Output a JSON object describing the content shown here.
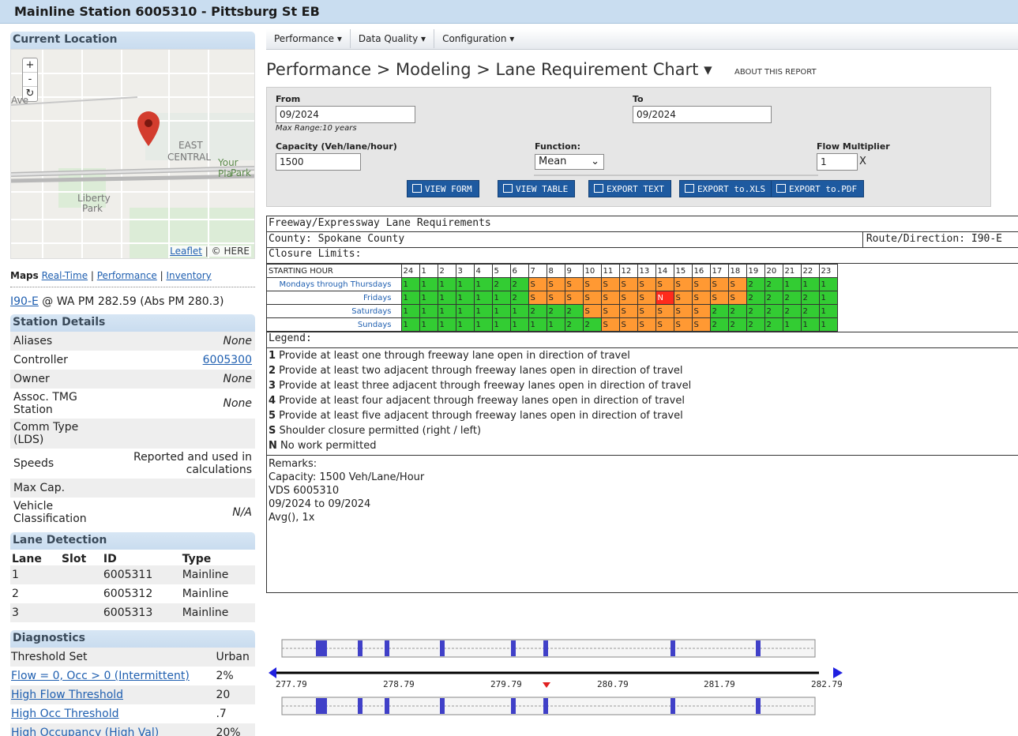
{
  "page_title": "Mainline Station 6005310 - Pittsburg St EB",
  "sidebar": {
    "current_location_title": "Current Location",
    "map": {
      "zoom_in": "+",
      "zoom_out": "-",
      "labels": [
        "Ave",
        "EAST",
        "CENTRAL",
        "Your Pla",
        "Park",
        "Liberty",
        "Park"
      ],
      "attribution_link": "Leaflet",
      "attribution_text": "| © HERE"
    },
    "maps_label": "Maps",
    "maps_links": [
      "Real-Time",
      "Performance",
      "Inventory"
    ],
    "route_link": "I90-E",
    "route_text": "@ WA PM 282.59 (Abs PM 280.3)",
    "station_details_title": "Station Details",
    "station_details": [
      {
        "label": "Aliases",
        "value": "None"
      },
      {
        "label": "Controller",
        "value": "6005300"
      },
      {
        "label": "Owner",
        "value": "None"
      },
      {
        "label": "Assoc. TMG Station",
        "value": "None"
      },
      {
        "label": "Comm Type (LDS)",
        "value": ""
      },
      {
        "label": "Speeds",
        "value": "Reported and used in calculations"
      },
      {
        "label": "Max Cap.",
        "value": ""
      },
      {
        "label": "Vehicle Classification",
        "value": "N/A"
      }
    ],
    "lane_detection_title": "Lane Detection",
    "lane_headers": [
      "Lane",
      "Slot",
      "ID",
      "Type"
    ],
    "lanes": [
      {
        "lane": "1",
        "slot": "",
        "id": "6005311",
        "type": "Mainline"
      },
      {
        "lane": "2",
        "slot": "",
        "id": "6005312",
        "type": "Mainline"
      },
      {
        "lane": "3",
        "slot": "",
        "id": "6005313",
        "type": "Mainline"
      }
    ],
    "diagnostics_title": "Diagnostics",
    "diagnostics": [
      {
        "label": "Threshold Set",
        "value": "Urban"
      },
      {
        "label": "Flow = 0, Occ > 0 (Intermittent)",
        "value": "2%"
      },
      {
        "label": "High Flow Threshold",
        "value": "20"
      },
      {
        "label": "High Occ Threshold",
        "value": ".7"
      },
      {
        "label": "High Occupancy (High Val)",
        "value": "20%"
      }
    ]
  },
  "menu": [
    "Performance ▾",
    "Data Quality ▾",
    "Configuration ▾"
  ],
  "breadcrumb": "Performance > Modeling > Lane Requirement Chart ▾",
  "about_link": "ABOUT THIS REPORT",
  "form": {
    "from_label": "From",
    "from_value": "09/2024",
    "max_range": "Max Range:10 years",
    "to_label": "To",
    "to_value": "09/2024",
    "capacity_label": "Capacity (Veh/lane/hour)",
    "capacity_value": "1500",
    "function_label": "Function:",
    "function_value": "Mean",
    "flow_label": "Flow Multiplier",
    "flow_value": "1",
    "flow_suffix": "X",
    "buttons": [
      "VIEW FORM",
      "VIEW TABLE",
      "EXPORT TEXT",
      "EXPORT to.XLS",
      "EXPORT to.PDF"
    ]
  },
  "report": {
    "title": "Freeway/Expressway Lane Requirements",
    "county": "County: Spokane County",
    "route": "Route/Direction: I90-E",
    "closure": "Closure Limits:",
    "start_label": "STARTING HOUR",
    "hours": [
      "24",
      "1",
      "2",
      "3",
      "4",
      "5",
      "6",
      "7",
      "8",
      "9",
      "10",
      "11",
      "12",
      "13",
      "14",
      "15",
      "16",
      "17",
      "18",
      "19",
      "20",
      "21",
      "22",
      "23"
    ],
    "rows": [
      {
        "day": "Mondays through Thursdays",
        "cells": [
          "1",
          "1",
          "1",
          "1",
          "1",
          "2",
          "2",
          "S",
          "S",
          "S",
          "S",
          "S",
          "S",
          "S",
          "S",
          "S",
          "S",
          "S",
          "S",
          "2",
          "2",
          "1",
          "1",
          "1"
        ]
      },
      {
        "day": "Fridays",
        "cells": [
          "1",
          "1",
          "1",
          "1",
          "1",
          "1",
          "2",
          "S",
          "S",
          "S",
          "S",
          "S",
          "S",
          "S",
          "N",
          "S",
          "S",
          "S",
          "S",
          "2",
          "2",
          "2",
          "2",
          "1"
        ]
      },
      {
        "day": "Saturdays",
        "cells": [
          "1",
          "1",
          "1",
          "1",
          "1",
          "1",
          "1",
          "2",
          "2",
          "2",
          "S",
          "S",
          "S",
          "S",
          "S",
          "S",
          "S",
          "2",
          "2",
          "2",
          "2",
          "2",
          "2",
          "1"
        ]
      },
      {
        "day": "Sundays",
        "cells": [
          "1",
          "1",
          "1",
          "1",
          "1",
          "1",
          "1",
          "1",
          "1",
          "2",
          "2",
          "S",
          "S",
          "S",
          "S",
          "S",
          "S",
          "2",
          "2",
          "2",
          "2",
          "1",
          "1",
          "1"
        ]
      }
    ],
    "legend_title": "Legend:",
    "legend": [
      {
        "key": "1",
        "text": "Provide at least one through freeway lane open in direction of travel"
      },
      {
        "key": "2",
        "text": "Provide at least two adjacent through freeway lanes open in direction of travel"
      },
      {
        "key": "3",
        "text": "Provide at least three adjacent through freeway lanes open in direction of travel"
      },
      {
        "key": "4",
        "text": "Provide at least four adjacent through freeway lanes open in direction of travel"
      },
      {
        "key": "5",
        "text": "Provide at least five adjacent through freeway lanes open in direction of travel"
      },
      {
        "key": "S",
        "text": "Shoulder closure permitted (right / left)"
      },
      {
        "key": "N",
        "text": "No work permitted"
      }
    ],
    "remarks": [
      "Remarks:",
      "Capacity: 1500 Veh/Lane/Hour",
      "VDS 6005310",
      "09/2024 to 09/2024",
      "Avg(), 1x"
    ]
  },
  "strip": {
    "ticks": [
      "277.79",
      "278.79",
      "279.79",
      "280.79",
      "281.79",
      "282.79"
    ]
  },
  "colors": {
    "green": "#33cc33",
    "orange": "#ff9933",
    "red": "#ff2b1c",
    "button": "#1e5aa0"
  }
}
